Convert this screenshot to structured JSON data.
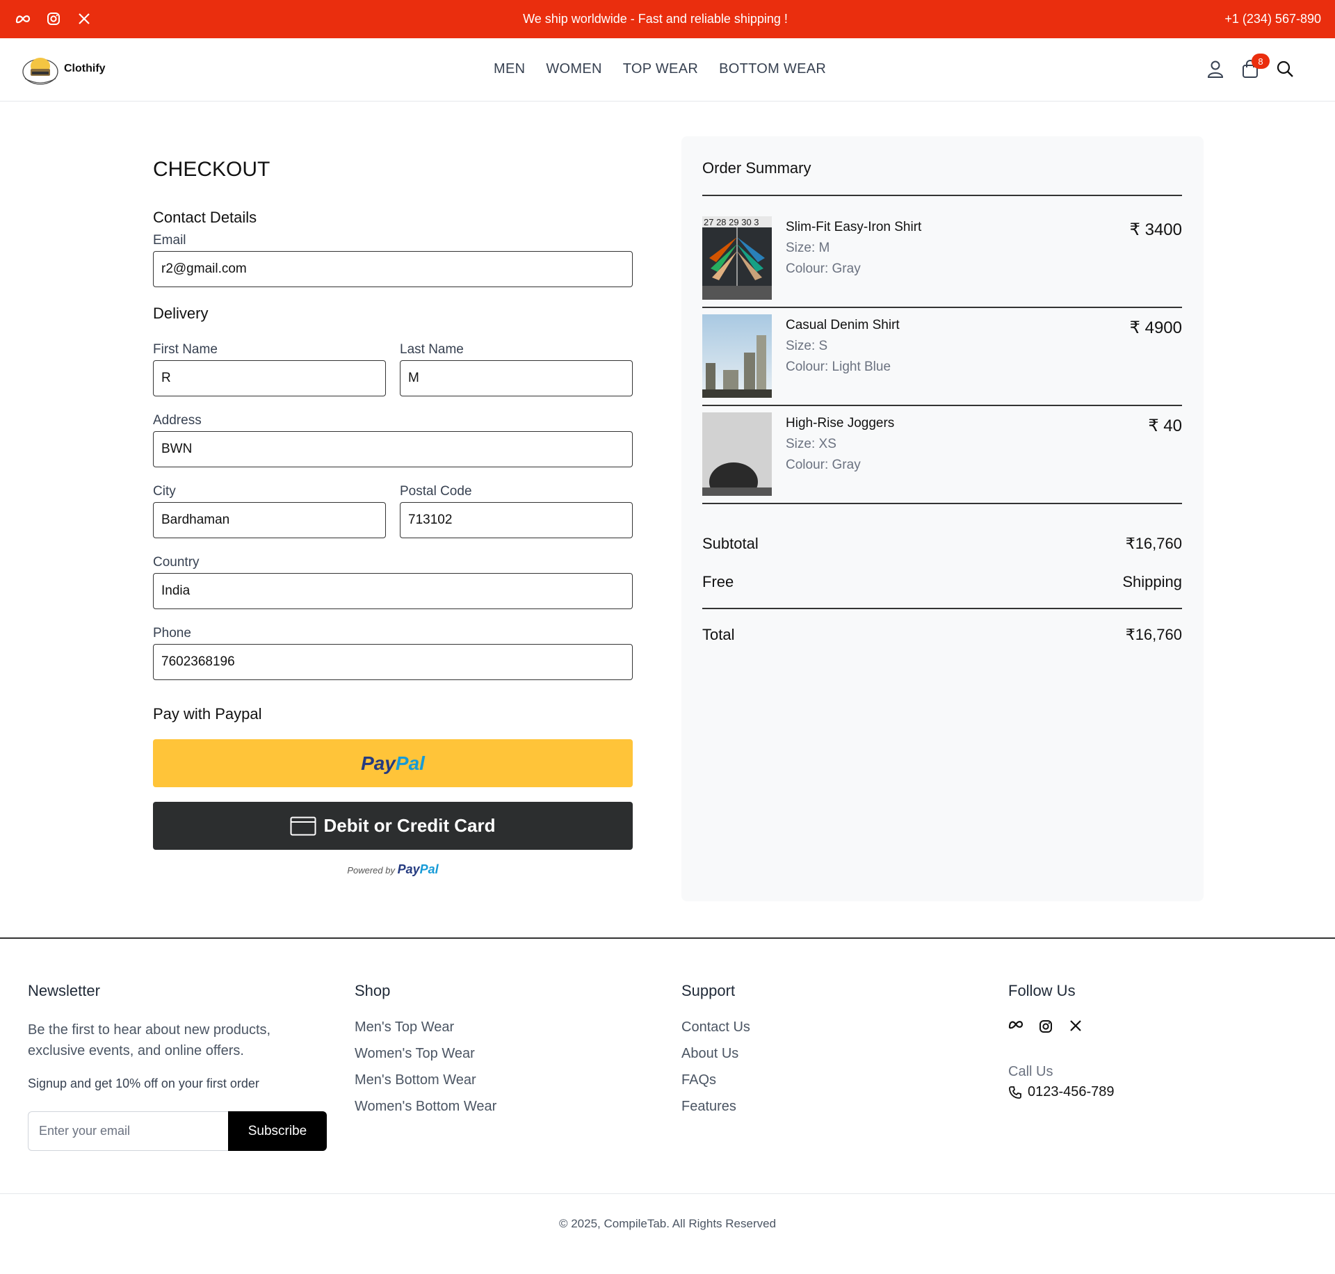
{
  "topbar": {
    "message": "We ship worldwide - Fast and reliable shipping !",
    "phone": "+1 (234) 567-890",
    "social_icons": [
      "meta-icon",
      "instagram-icon",
      "x-icon"
    ]
  },
  "header": {
    "brand": "Clothify",
    "nav": [
      "MEN",
      "WOMEN",
      "TOP WEAR",
      "BOTTOM WEAR"
    ],
    "cart_count": "8"
  },
  "checkout": {
    "title": "CHECKOUT",
    "contact_title": "Contact Details",
    "email_label": "Email",
    "email_value": "r2@gmail.com",
    "delivery_title": "Delivery",
    "first_name_label": "First Name",
    "first_name_value": "R",
    "last_name_label": "Last Name",
    "last_name_value": "M",
    "address_label": "Address",
    "address_value": "BWN",
    "city_label": "City",
    "city_value": "Bardhaman",
    "postal_label": "Postal Code",
    "postal_value": "713102",
    "country_label": "Country",
    "country_value": "India",
    "phone_label": "Phone",
    "phone_value": "7602368196",
    "pay_title": "Pay with Paypal",
    "paypal_pay": "Pay",
    "paypal_pal": "Pal",
    "card_label": "Debit or Credit Card",
    "powered_by": "Powered by"
  },
  "summary": {
    "title": "Order Summary",
    "items": [
      {
        "name": "Slim-Fit Easy-Iron Shirt",
        "size": "Size: M",
        "colour": "Colour: Gray",
        "price": "₹ 3400",
        "thumb_text": "27 28 29 30 3"
      },
      {
        "name": "Casual Denim Shirt",
        "size": "Size: S",
        "colour": "Colour: Light Blue",
        "price": "₹ 4900"
      },
      {
        "name": "High-Rise Joggers",
        "size": "Size: XS",
        "colour": "Colour: Gray",
        "price": "₹ 40"
      }
    ],
    "subtotal_label": "Subtotal",
    "subtotal_value": "₹16,760",
    "shipping_label": "Free",
    "shipping_value": "Shipping",
    "total_label": "Total",
    "total_value": "₹16,760"
  },
  "footer": {
    "newsletter_title": "Newsletter",
    "newsletter_text": "Be the first to hear about new products, exclusive events, and online offers.",
    "newsletter_sub": "Signup and get 10% off on your first order",
    "email_placeholder": "Enter your email",
    "subscribe_label": "Subscribe",
    "shop_title": "Shop",
    "shop_links": [
      "Men's Top Wear",
      "Women's Top Wear",
      "Men's Bottom Wear",
      "Women's Bottom Wear"
    ],
    "support_title": "Support",
    "support_links": [
      "Contact Us",
      "About Us",
      "FAQs",
      "Features"
    ],
    "follow_title": "Follow Us",
    "call_label": "Call Us",
    "call_number": "0123-456-789",
    "copyright": "© 2025, CompileTab. All Rights Reserved"
  }
}
